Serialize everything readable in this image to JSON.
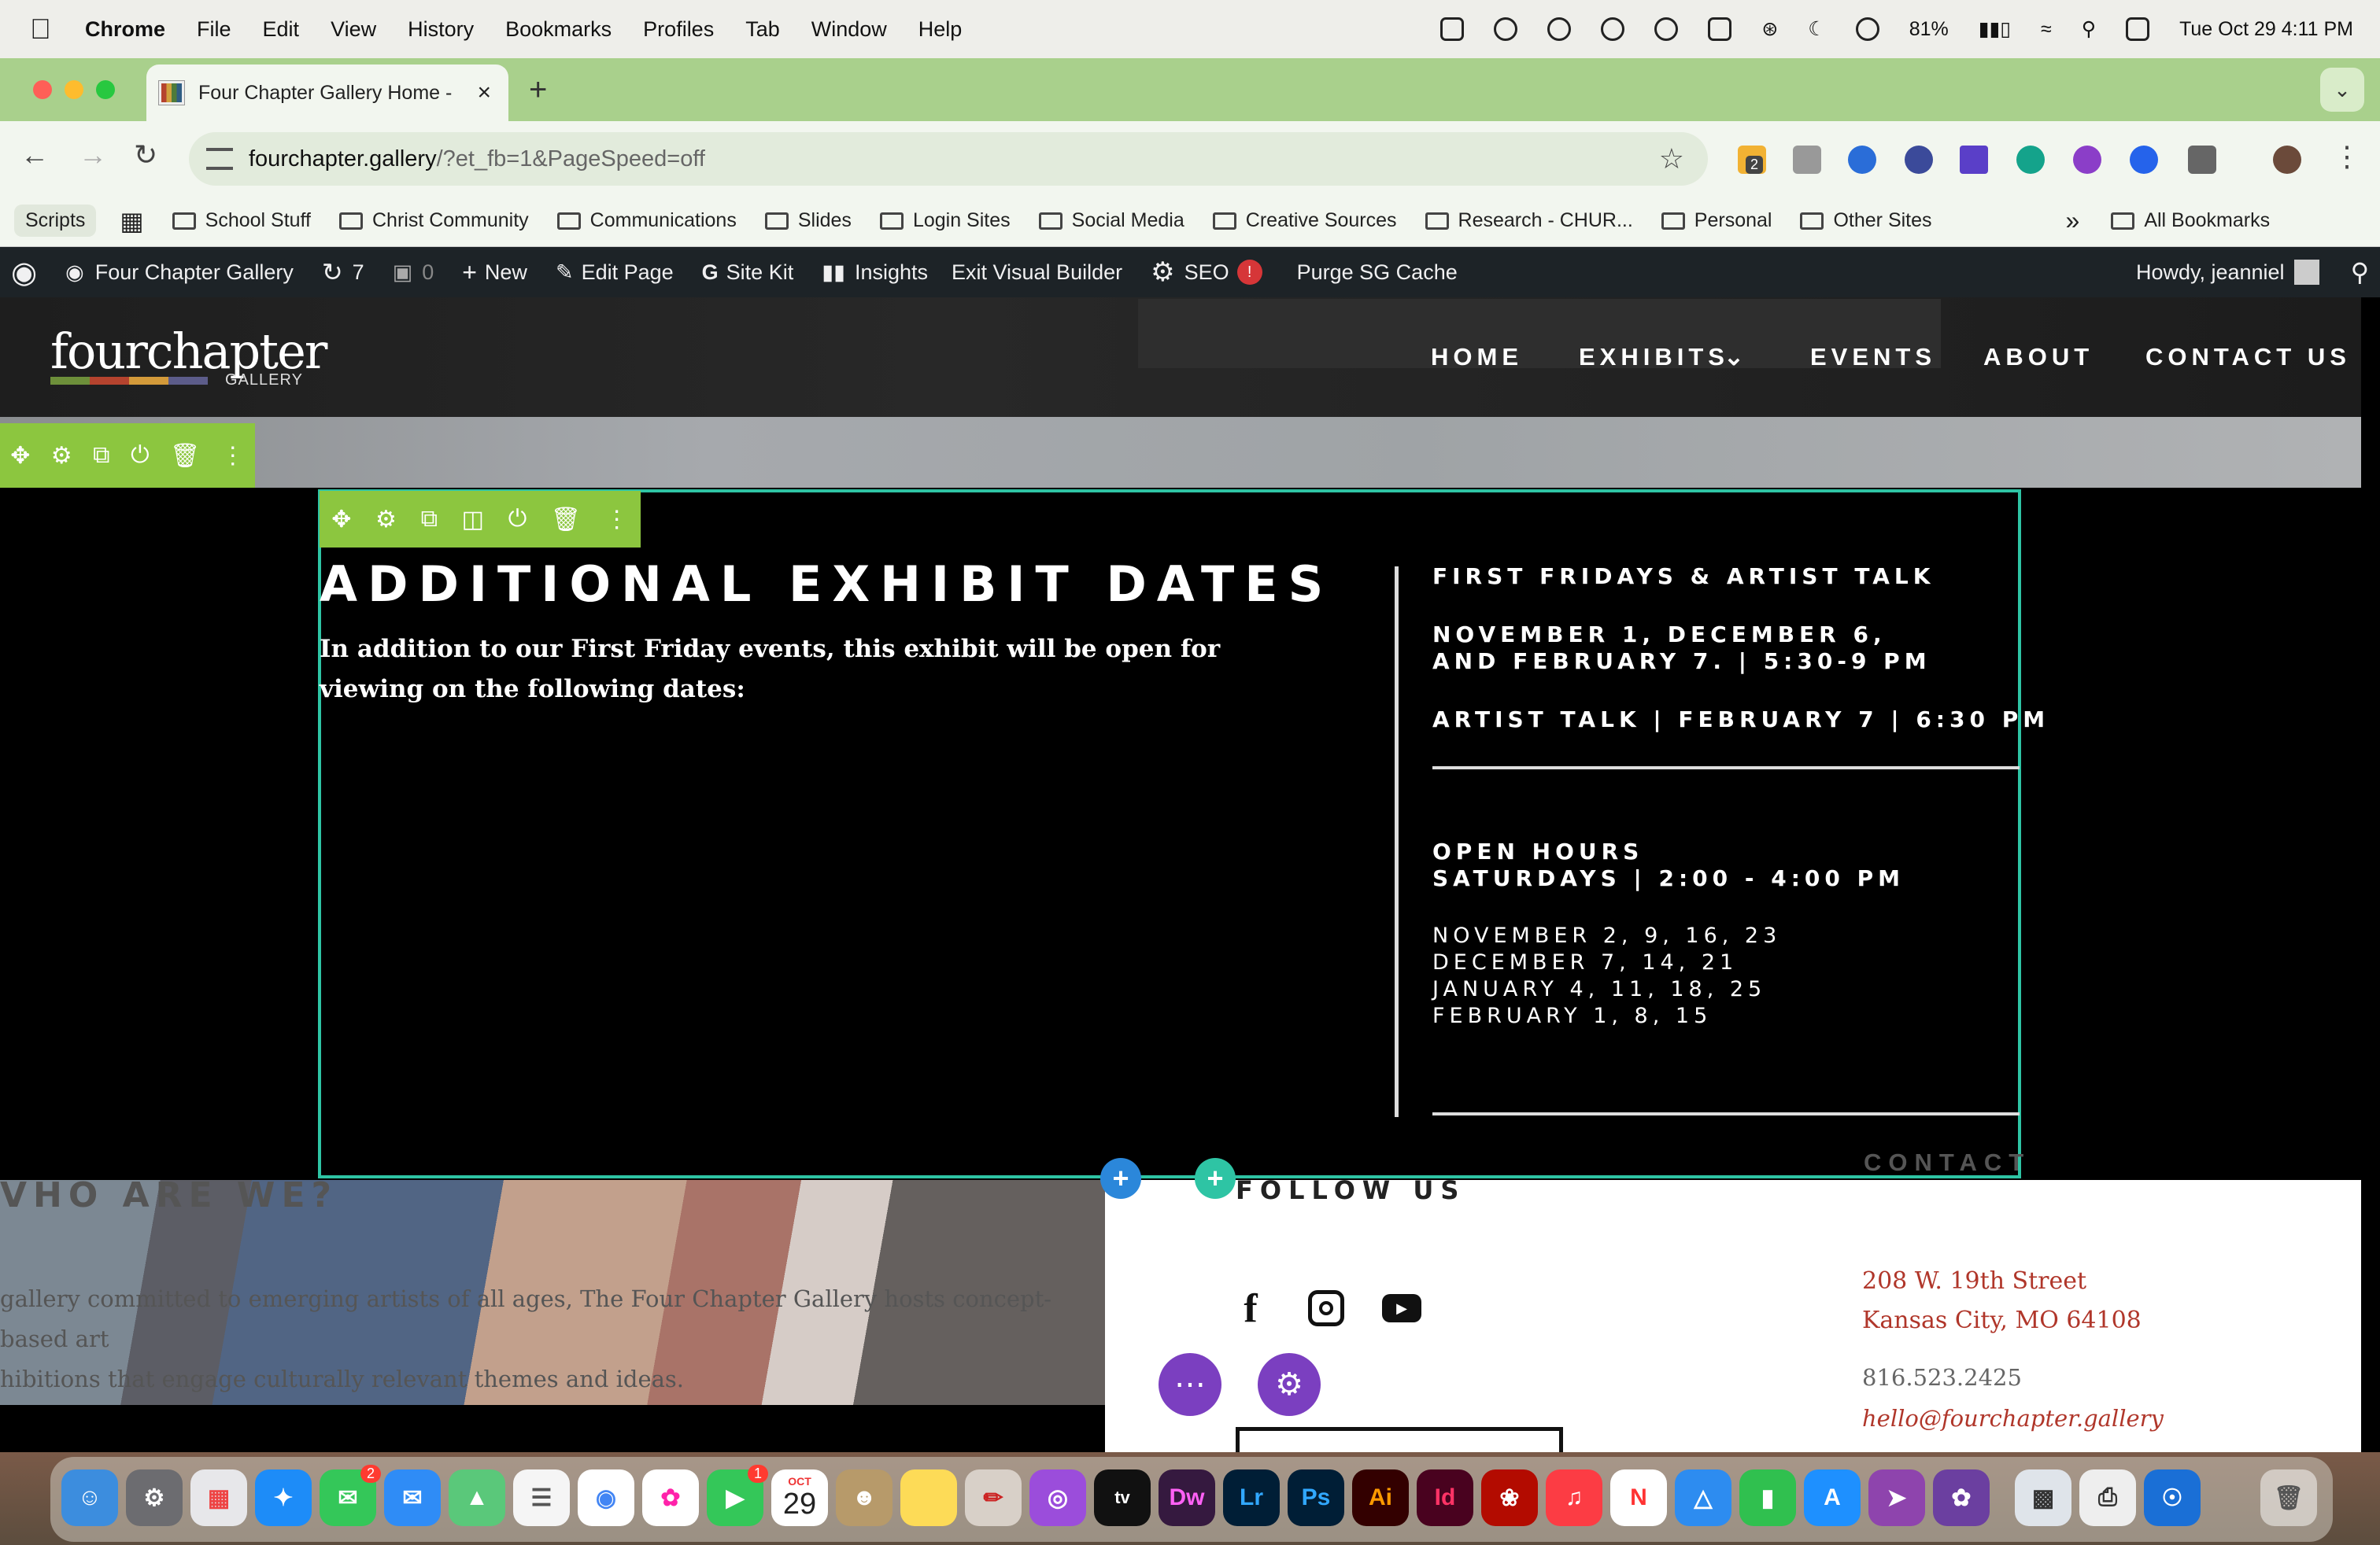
{
  "os_menubar": {
    "app": "Chrome",
    "menus": [
      "File",
      "Edit",
      "View",
      "History",
      "Bookmarks",
      "Profiles",
      "Tab",
      "Window",
      "Help"
    ],
    "battery": "81%",
    "datetime": "Tue Oct 29  4:11 PM"
  },
  "browser": {
    "tab_title": "Four Chapter Gallery Home -",
    "url_host": "fourchapter.gallery",
    "url_rest": "/?et_fb=1&PageSpeed=off",
    "extension_badge": "2",
    "bookmarks": [
      "Scripts",
      "School Stuff",
      "Christ Community",
      "Communications",
      "Slides",
      "Login Sites",
      "Social Media",
      "Creative Sources",
      "Research - CHUR...",
      "Personal",
      "Other Sites"
    ],
    "bookmarks_overflow": "»",
    "all_bookmarks": "All Bookmarks"
  },
  "wp_admin": {
    "site_name": "Four Chapter Gallery",
    "updates": "7",
    "comments": "0",
    "new": "New",
    "edit_page": "Edit Page",
    "site_kit": "Site Kit",
    "insights": "Insights",
    "exit_builder": "Exit Visual Builder",
    "seo": "SEO",
    "seo_alert": "!",
    "purge": "Purge SG Cache",
    "howdy": "Howdy, jeanniel"
  },
  "site": {
    "logo_word": "fourchapter",
    "logo_sub": "GALLERY",
    "logo_colors": [
      "#6d8f3a",
      "#b5432e",
      "#d39a3a",
      "#5c5c8a"
    ],
    "nav": [
      "HOME",
      "EXHIBITS",
      "EVENTS",
      "ABOUT",
      "CONTACT US"
    ]
  },
  "exhibit": {
    "heading": "ADDITIONAL EXHIBIT DATES",
    "intro": "In addition to our First Friday events, this exhibit will be open for viewing on the following dates:",
    "ff_title": "FIRST FRIDAYS & ARTIST TALK",
    "ff_dates_1": "NOVEMBER 1, DECEMBER 6,",
    "ff_dates_2": "AND FEBRUARY 7. |  5:30-9 PM",
    "artist_talk": "ARTIST TALK | FEBRUARY 7  | 6:30 PM",
    "open_hours_title": "OPEN HOURS",
    "open_hours_time": "SATURDAYS | 2:00 - 4:00 PM",
    "dates": [
      "NOVEMBER 2, 9, 16, 23",
      "DECEMBER 7, 14, 21",
      "JANUARY 4, 11, 18, 25",
      "FEBRUARY 1, 8, 15"
    ],
    "contact_faint": "CONTACT"
  },
  "footer": {
    "who_heading": "VHO ARE WE?",
    "who_line1": "gallery committed to emerging artists of all ages, The Four Chapter Gallery hosts concept-based art",
    "who_line2": "hibitions that engage culturally relevant themes and ideas.",
    "follow": "FOLLOW US",
    "address1": "208 W. 19th Street",
    "address2": "Kansas City, MO 64108",
    "phone": "816.523.2425",
    "email": "hello@fourchapter.gallery",
    "builder_colors": {
      "row": "#8cc63f",
      "module": "#2ec4a4",
      "section": "#2b87da",
      "page": "#7b3fc0"
    }
  },
  "dock": {
    "messages_badge": "2",
    "facetime_badge": "1",
    "calendar_month": "OCT",
    "calendar_day": "29",
    "labels": [
      "Dw",
      "Lr",
      "Ps",
      "Ai",
      "Id"
    ]
  }
}
